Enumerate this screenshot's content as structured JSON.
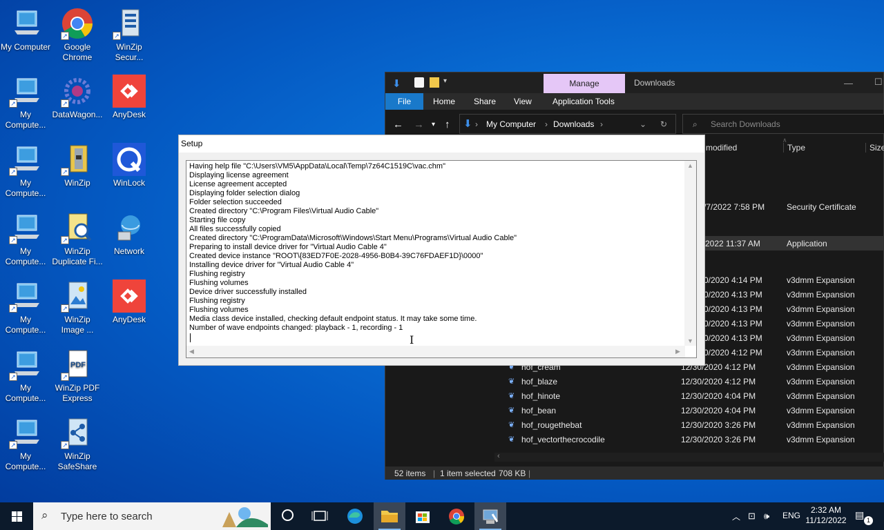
{
  "desktop_icons": [
    {
      "label": "My Computer",
      "icon": "computer-icon"
    },
    {
      "label": "Google Chrome",
      "icon": "chrome-icon"
    },
    {
      "label": "WinZip Secur...",
      "icon": "winzip-secure-icon"
    },
    {
      "label": "My Compute...",
      "icon": "computer-icon"
    },
    {
      "label": "DataWagon...",
      "icon": "datawagon-icon"
    },
    {
      "label": "AnyDesk",
      "icon": "anydesk-icon"
    },
    {
      "label": "My Compute...",
      "icon": "computer-icon"
    },
    {
      "label": "WinZip",
      "icon": "winzip-icon"
    },
    {
      "label": "WinLock",
      "icon": "winlock-icon"
    },
    {
      "label": "My Compute...",
      "icon": "computer-icon"
    },
    {
      "label": "WinZip Duplicate Fi...",
      "icon": "winzip-duplicate-icon"
    },
    {
      "label": "Network",
      "icon": "network-icon"
    },
    {
      "label": "My Compute...",
      "icon": "computer-icon"
    },
    {
      "label": "WinZip Image ...",
      "icon": "winzip-image-icon"
    },
    {
      "label": "AnyDesk",
      "icon": "anydesk-icon"
    },
    {
      "label": "My Compute...",
      "icon": "computer-icon"
    },
    {
      "label": "WinZip PDF Express",
      "icon": "winzip-pdf-icon"
    },
    {
      "label": "My Compute...",
      "icon": "computer-icon"
    },
    {
      "label": "WinZip SafeShare",
      "icon": "winzip-safeshare-icon"
    }
  ],
  "explorer": {
    "manage_tab": "Manage",
    "title": "Downloads",
    "ribbon": {
      "file": "File",
      "home": "Home",
      "share": "Share",
      "view": "View",
      "app_tools": "Application Tools"
    },
    "breadcrumb": [
      "My Computer",
      "Downloads"
    ],
    "search_placeholder": "Search Downloads",
    "columns": {
      "modified": "modified",
      "type": "Type",
      "size": "Size"
    },
    "rows": [
      {
        "name": "",
        "date": "/7/2022 7:58 PM",
        "type": "Security Certificate"
      },
      {
        "name": "",
        "date": "2022 11:37 AM",
        "type": "Application"
      },
      {
        "name": "",
        "date": "0/2020 4:14 PM",
        "type": "v3dmm Expansion"
      },
      {
        "name": "",
        "date": "0/2020 4:13 PM",
        "type": "v3dmm Expansion"
      },
      {
        "name": "",
        "date": "0/2020 4:13 PM",
        "type": "v3dmm Expansion"
      },
      {
        "name": "",
        "date": "0/2020 4:13 PM",
        "type": "v3dmm Expansion"
      },
      {
        "name": "",
        "date": "0/2020 4:13 PM",
        "type": "v3dmm Expansion"
      },
      {
        "name": "",
        "date": "0/2020 4:12 PM",
        "type": "v3dmm Expansion"
      },
      {
        "name": "hof_cream",
        "date": "12/30/2020 4:12 PM",
        "type": "v3dmm Expansion"
      },
      {
        "name": "hof_blaze",
        "date": "12/30/2020 4:12 PM",
        "type": "v3dmm Expansion"
      },
      {
        "name": "hof_hinote",
        "date": "12/30/2020 4:04 PM",
        "type": "v3dmm Expansion"
      },
      {
        "name": "hof_bean",
        "date": "12/30/2020 4:04 PM",
        "type": "v3dmm Expansion"
      },
      {
        "name": "hof_rougethebat",
        "date": "12/30/2020 3:26 PM",
        "type": "v3dmm Expansion"
      },
      {
        "name": "hof_vectorthecrocodile",
        "date": "12/30/2020 3:26 PM",
        "type": "v3dmm Expansion"
      }
    ],
    "status": {
      "items": "52 items",
      "selected": "1 item selected",
      "size": "708 KB"
    }
  },
  "setup": {
    "title": "Setup",
    "log": "Having help file \"C:\\Users\\VM5\\AppData\\Local\\Temp\\7z64C1519C\\vac.chm\"\nDisplaying license agreement\nLicense agreement accepted\nDisplaying folder selection dialog\nFolder selection succeeded\nCreated directory \"C:\\Program Files\\Virtual Audio Cable\"\nStarting file copy\nAll files successfully copied\nCreated directory \"C:\\ProgramData\\Microsoft\\Windows\\Start Menu\\Programs\\Virtual Audio Cable\"\nPreparing to install device driver for \"Virtual Audio Cable 4\"\nCreated device instance \"ROOT\\{83ED7F0E-2028-4956-B0B4-39C76FDAEF1D}\\0000\"\nInstalling device driver for \"Virtual Audio Cable 4\"\nFlushing registry\nFlushing volumes\nDevice driver successfully installed\nFlushing registry\nFlushing volumes\nMedia class device installed, checking default endpoint status. It may take some time.\nNumber of wave endpoints changed: playback - 1, recording - 1"
  },
  "taskbar": {
    "search_placeholder": "Type here to search",
    "lang": "ENG",
    "time": "2:32 AM",
    "date": "11/12/2022",
    "notifications": "1"
  }
}
